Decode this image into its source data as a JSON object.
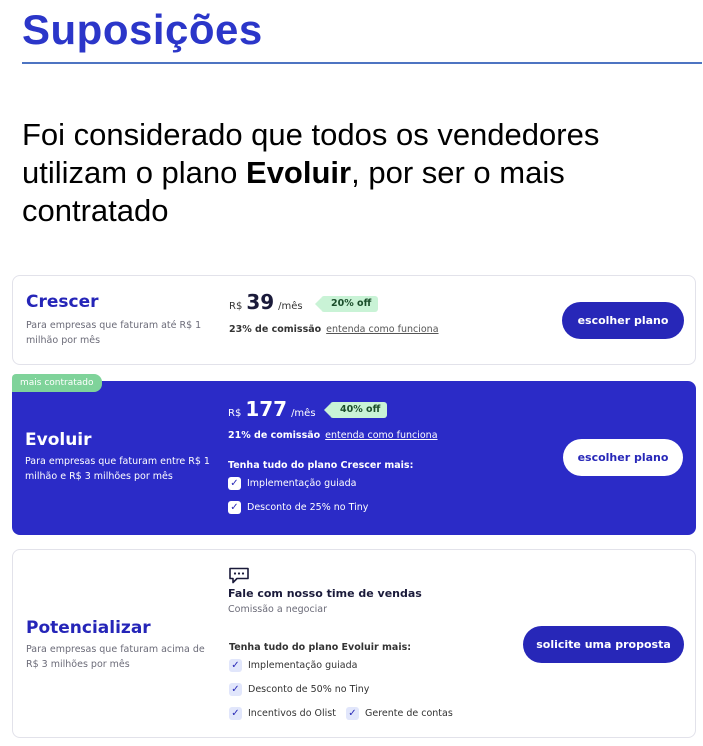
{
  "slide": {
    "title": "Suposições",
    "body_before": "Foi considerado que todos os vendedores utilizam o plano ",
    "body_bold": "Evoluir",
    "body_after": ", por ser o mais contratado"
  },
  "plans": {
    "crescer": {
      "name": "Crescer",
      "description": "Para empresas que faturam até R$ 1 milhão por mês",
      "currency": "R$",
      "price": "39",
      "period": "/mês",
      "discount": "20% off",
      "commission": "23% de comissão",
      "commission_link": "entenda como funciona",
      "button": "escolher plano"
    },
    "evoluir": {
      "badge": "mais contratado",
      "name": "Evoluir",
      "description": "Para empresas que faturam entre R$ 1 milhão e R$ 3 milhões por mês",
      "currency": "R$",
      "price": "177",
      "period": "/mês",
      "discount": "40% off",
      "commission": "21% de comissão",
      "commission_link": "entenda como funciona",
      "features_heading": "Tenha tudo do plano Crescer mais:",
      "features": [
        "Implementação guiada",
        "Desconto de 25% no Tiny"
      ],
      "button": "escolher plano"
    },
    "potencializar": {
      "name": "Potencializar",
      "description": "Para empresas que faturam acima de R$ 3 milhões por mês",
      "icon": "chat-icon",
      "talk_title": "Fale com nosso time de vendas",
      "talk_subtitle": "Comissão a negociar",
      "features_heading": "Tenha tudo do plano Evoluir mais:",
      "features": [
        "Implementação guiada",
        "Desconto de 50% no Tiny",
        "Incentivos do Olist",
        "Gerente de contas"
      ],
      "button": "solicite uma proposta"
    }
  },
  "colors": {
    "title": "#2b36c9",
    "featured_background": "#2b2bc7",
    "button": "#2727b8",
    "discount_background": "#c9f3d6",
    "badge": "#7fd39a"
  }
}
